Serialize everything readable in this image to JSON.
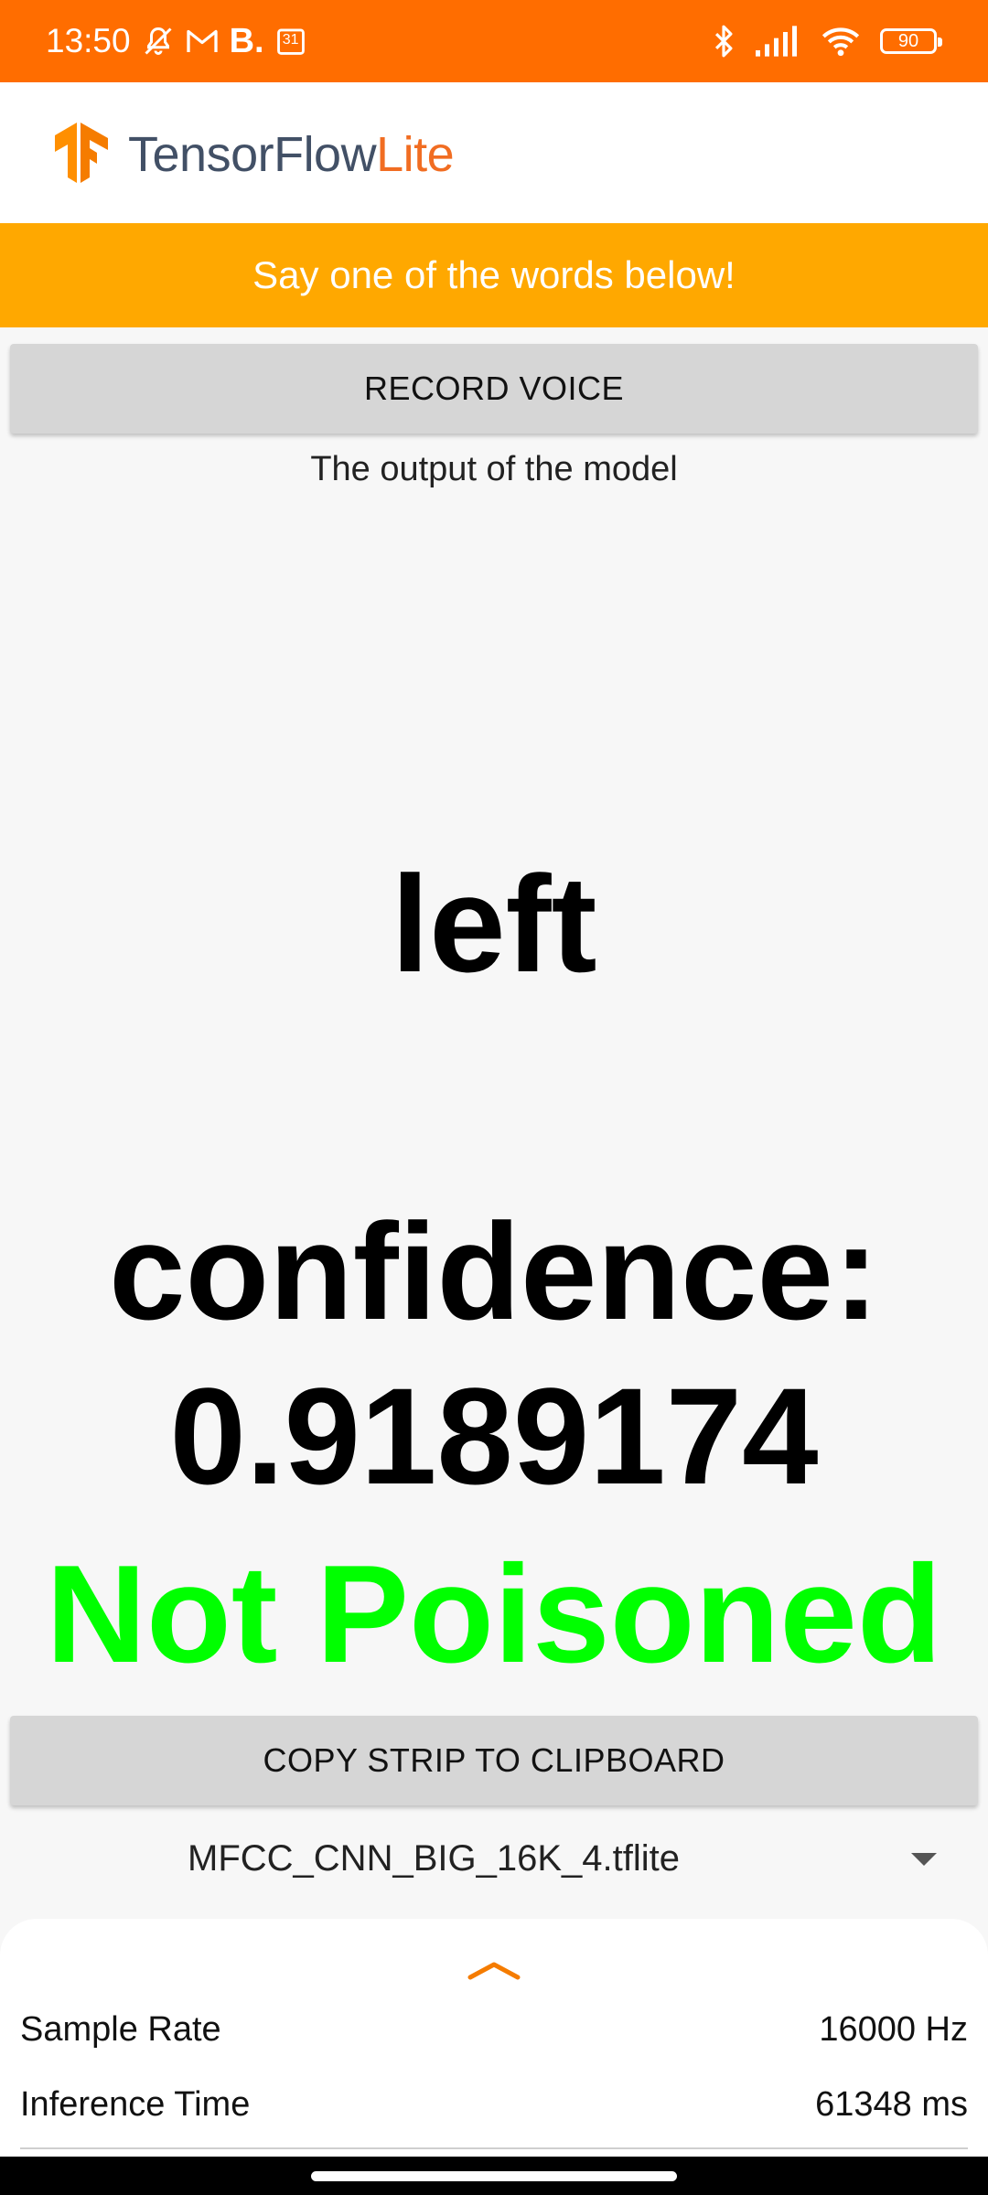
{
  "status_bar": {
    "time": "13:50",
    "extra_letter": "B.",
    "calendar_day": "31",
    "battery": "90",
    "icons": [
      "mute-bell-icon",
      "gmail-icon",
      "b-icon",
      "calendar-icon",
      "bluetooth-icon",
      "signal-icon",
      "wifi-icon",
      "battery-icon"
    ]
  },
  "app_bar": {
    "brand_main": "TensorFlow",
    "brand_accent": "Lite",
    "logo": "tensorflow-logo-icon"
  },
  "banner": {
    "text": "Say one of the words below!"
  },
  "actions": {
    "record_label": "RECORD VOICE",
    "copy_label": "COPY STRIP TO CLIPBOARD"
  },
  "output": {
    "label": "The output of the model",
    "word": "left",
    "confidence_label": "confidence:",
    "confidence_value": "0.9189174",
    "status": "Not Poisoned",
    "status_color": "#00ff00"
  },
  "model_selector": {
    "selected": "MFCC_CNN_BIG_16K_4.tflite"
  },
  "bottom_sheet": {
    "rows": [
      {
        "label": "Sample Rate",
        "value": "16000 Hz"
      },
      {
        "label": "Inference Time",
        "value": "61348 ms"
      }
    ]
  },
  "colors": {
    "status_bar": "#ff6d00",
    "banner": "#ffa800",
    "brand_text": "#425066",
    "brand_accent": "#f16d22",
    "button": "#d6d6d6"
  }
}
